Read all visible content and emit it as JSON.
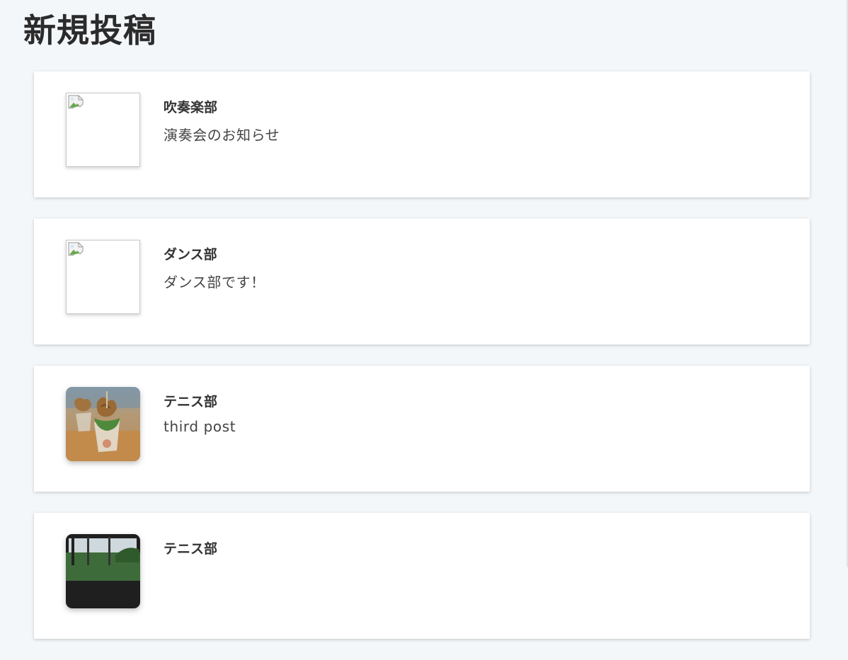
{
  "page": {
    "title": "新規投稿"
  },
  "posts": [
    {
      "club": "吹奏楽部",
      "body": "演奏会のお知らせ",
      "image": "broken"
    },
    {
      "club": "ダンス部",
      "body": "ダンス部です！",
      "image": "broken"
    },
    {
      "club": "テニス部",
      "body": "third post",
      "image": "photo-food"
    },
    {
      "club": "テニス部",
      "body": "",
      "image": "photo-outdoor"
    }
  ],
  "icons": {
    "broken_image": "broken-image-icon"
  },
  "colors": {
    "background": "#f4f7fa",
    "card": "#ffffff",
    "title_text": "#2b2b2b",
    "body_text": "#444444"
  }
}
